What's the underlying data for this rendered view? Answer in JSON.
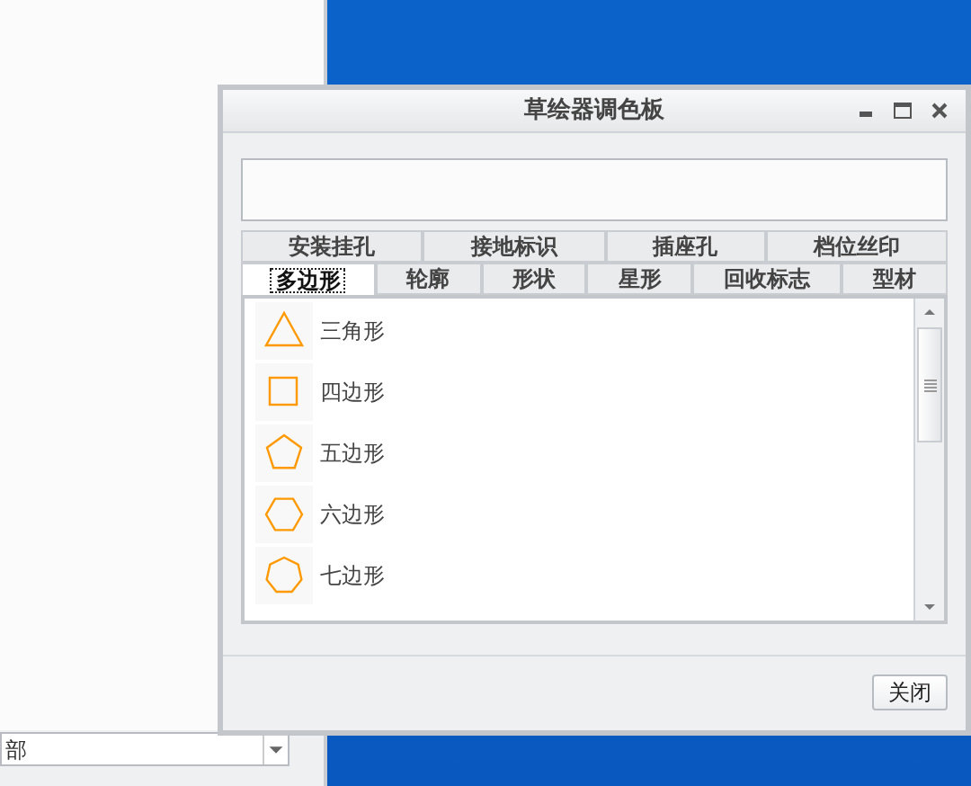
{
  "background_filter": {
    "value": "部"
  },
  "window": {
    "title": "草绘器调色板",
    "controls": [
      {
        "kind": "minimize"
      },
      {
        "kind": "maximize"
      },
      {
        "kind": "close"
      }
    ]
  },
  "tab_rows": [
    [
      {
        "label": "安装挂孔",
        "selected": false
      },
      {
        "label": "接地标识",
        "selected": false
      },
      {
        "label": "插座孔",
        "selected": false
      },
      {
        "label": "档位丝印",
        "selected": false
      }
    ],
    [
      {
        "label": "多边形",
        "selected": true
      },
      {
        "label": "轮廓",
        "selected": false
      },
      {
        "label": "形状",
        "selected": false
      },
      {
        "label": "星形",
        "selected": false
      },
      {
        "label": "回收标志",
        "selected": false
      },
      {
        "label": "型材",
        "selected": false
      }
    ]
  ],
  "shapes": [
    {
      "kind": "triangle",
      "label": "三角形"
    },
    {
      "kind": "square",
      "label": "四边形"
    },
    {
      "kind": "pentagon",
      "label": "五边形"
    },
    {
      "kind": "hexagon",
      "label": "六边形"
    },
    {
      "kind": "heptagon",
      "label": "七边形"
    }
  ],
  "buttons": [
    "关闭"
  ]
}
